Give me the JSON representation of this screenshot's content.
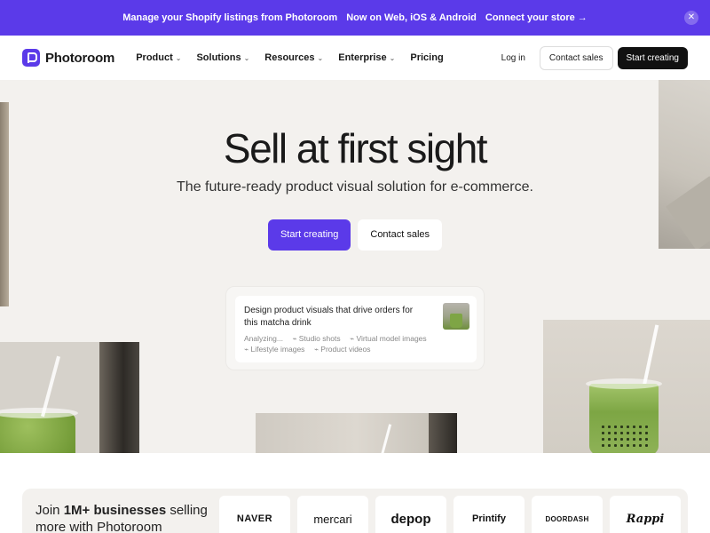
{
  "announcement": {
    "item1": "Manage your Shopify listings from Photoroom",
    "item2": "Now on Web, iOS & Android",
    "item3": "Connect your store →",
    "close": "✕"
  },
  "nav": {
    "brand": "Photoroom",
    "menu": [
      {
        "label": "Product",
        "chevron": "⌄"
      },
      {
        "label": "Solutions",
        "chevron": "⌄"
      },
      {
        "label": "Resources",
        "chevron": "⌄"
      },
      {
        "label": "Enterprise",
        "chevron": "⌄"
      },
      {
        "label": "Pricing"
      }
    ],
    "login": "Log in",
    "contact": "Contact sales",
    "cta": "Start creating"
  },
  "hero": {
    "title": "Sell at first sight",
    "subtitle": "The future-ready product visual solution for e-commerce.",
    "primary_cta": "Start creating",
    "secondary_cta": "Contact sales"
  },
  "prompt": {
    "text": "Design product visuals that drive orders for this matcha drink",
    "tags": [
      "Analyzing...",
      "⌁ Studio shots",
      "⌁ Virtual model images",
      "⌁ Lifestyle images",
      "⌁ Product videos"
    ]
  },
  "logos_section": {
    "join_prefix": "Join ",
    "join_bold": "1M+ businesses",
    "join_suffix": " selling more with Photoroom",
    "logos": [
      "NAVER",
      "mercari",
      "depop",
      "Printify",
      "DOORDASH",
      "Rappi"
    ]
  },
  "colors": {
    "brand": "#5b3ae9",
    "dark": "#111111",
    "hero_bg": "#f3f1ee"
  }
}
